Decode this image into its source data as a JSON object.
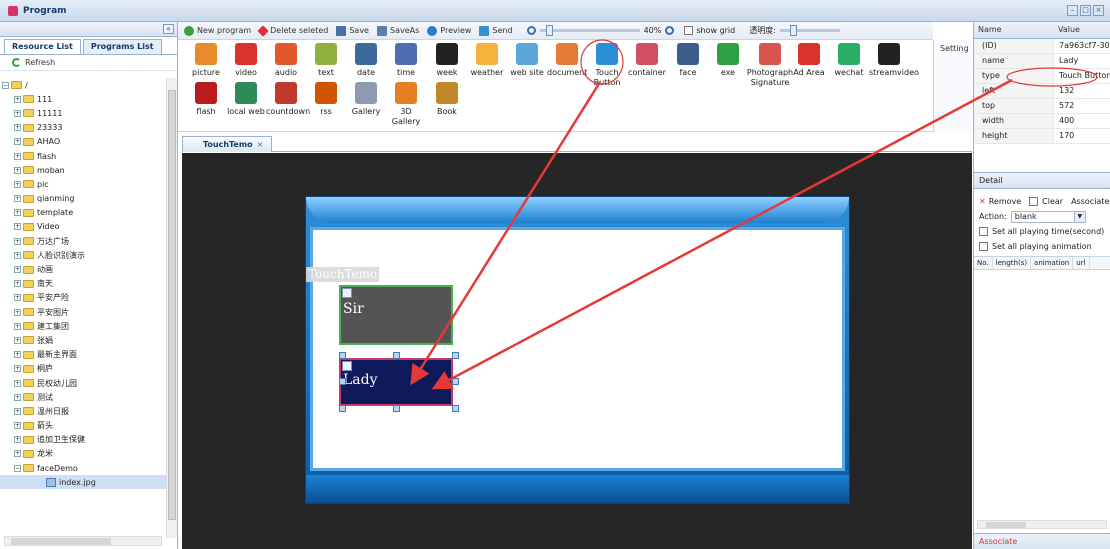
{
  "window": {
    "title": "Program"
  },
  "left_panel": {
    "tabs": [
      "Resource List",
      "Programs List"
    ],
    "refresh_label": "Refresh",
    "tree": [
      {
        "label": "/",
        "type": "root"
      },
      {
        "label": "111",
        "type": "folder"
      },
      {
        "label": "11111",
        "type": "folder"
      },
      {
        "label": "23333",
        "type": "folder"
      },
      {
        "label": "AHAO",
        "type": "folder"
      },
      {
        "label": "flash",
        "type": "folder"
      },
      {
        "label": "moban",
        "type": "folder"
      },
      {
        "label": "pic",
        "type": "folder"
      },
      {
        "label": "qianming",
        "type": "folder"
      },
      {
        "label": "template",
        "type": "folder"
      },
      {
        "label": "Video",
        "type": "folder"
      },
      {
        "label": "万达广场",
        "type": "folder"
      },
      {
        "label": "人脸识别演示",
        "type": "folder"
      },
      {
        "label": "动画",
        "type": "folder"
      },
      {
        "label": "南天",
        "type": "folder"
      },
      {
        "label": "平安产险",
        "type": "folder"
      },
      {
        "label": "平安图片",
        "type": "folder"
      },
      {
        "label": "建工集团",
        "type": "folder"
      },
      {
        "label": "张娟",
        "type": "folder"
      },
      {
        "label": "最新主界面",
        "type": "folder"
      },
      {
        "label": "桐庐",
        "type": "folder"
      },
      {
        "label": "民权幼儿园",
        "type": "folder"
      },
      {
        "label": "测试",
        "type": "folder"
      },
      {
        "label": "温州日报",
        "type": "folder"
      },
      {
        "label": "箭头",
        "type": "folder"
      },
      {
        "label": "追加卫生保健",
        "type": "folder"
      },
      {
        "label": "龙米",
        "type": "folder"
      },
      {
        "label": "faceDemo",
        "type": "folder-open"
      },
      {
        "label": "index.jpg",
        "type": "file"
      }
    ]
  },
  "toolbar": {
    "new_program": "New program",
    "delete_selected": "Delete seleted",
    "save": "Save",
    "saveas": "SaveAs",
    "preview": "Preview",
    "send": "Send",
    "zoom_value": "40%",
    "show_grid": "show grid",
    "opacity_label": "透明度:"
  },
  "palette": {
    "items": [
      {
        "label": "picture",
        "icon": "picture-icon",
        "color": "#e98b2a"
      },
      {
        "label": "video",
        "icon": "video-icon",
        "color": "#d9342b"
      },
      {
        "label": "audio",
        "icon": "audio-icon",
        "color": "#e2572b"
      },
      {
        "label": "text",
        "icon": "text-icon",
        "color": "#8fb13d"
      },
      {
        "label": "date",
        "icon": "date-icon",
        "color": "#3b6a9a"
      },
      {
        "label": "time",
        "icon": "time-icon",
        "color": "#4e6cb0"
      },
      {
        "label": "week",
        "icon": "week-icon",
        "color": "#222222"
      },
      {
        "label": "weather",
        "icon": "weather-icon",
        "color": "#f2b33d"
      },
      {
        "label": "web site",
        "icon": "website-icon",
        "color": "#5aa7d8"
      },
      {
        "label": "document",
        "icon": "document-icon",
        "color": "#e47a34"
      },
      {
        "label": "Touch Button",
        "icon": "touch-button-icon",
        "color": "#2b8fd8"
      },
      {
        "label": "container",
        "icon": "container-icon",
        "color": "#d24f63"
      },
      {
        "label": "face",
        "icon": "face-icon",
        "color": "#3c5c8b"
      },
      {
        "label": "exe",
        "icon": "exe-icon",
        "color": "#2ea043"
      },
      {
        "label": "Photograph Signature",
        "icon": "photograph-signature-icon",
        "color": "#d9534f"
      },
      {
        "label": "Ad Area",
        "icon": "ad-area-icon",
        "color": "#d9342b"
      },
      {
        "label": "wechat",
        "icon": "wechat-icon",
        "color": "#2aae67"
      },
      {
        "label": "streamvideo",
        "icon": "streamvideo-icon",
        "color": "#222222"
      },
      {
        "label": "flash",
        "icon": "flash-icon",
        "color": "#b81c1c"
      },
      {
        "label": "local web",
        "icon": "local-web-icon",
        "color": "#2e8b57"
      },
      {
        "label": "countdown",
        "icon": "countdown-icon",
        "color": "#c0392b"
      },
      {
        "label": "rss",
        "icon": "rss-icon",
        "color": "#d35400"
      },
      {
        "label": "Gallery",
        "icon": "gallery-icon",
        "color": "#8e9aaf"
      },
      {
        "label": "3D Gallery",
        "icon": "3d-gallery-icon",
        "color": "#e67e22"
      },
      {
        "label": "Book",
        "icon": "book-icon",
        "color": "#c0882a"
      }
    ],
    "setting_label": "Setting"
  },
  "editor": {
    "tab_label": "TouchTemo",
    "stage_label": "TouchTemo",
    "button_sir": "Sir",
    "button_lady": "Lady"
  },
  "properties": {
    "header": {
      "name": "Name",
      "value": "Value"
    },
    "rows": [
      {
        "name": "(ID)",
        "value": "7a963cf7-30..."
      },
      {
        "name": "name",
        "value": "Lady"
      },
      {
        "name": "type",
        "value": "Touch Button"
      },
      {
        "name": "left",
        "value": "132"
      },
      {
        "name": "top",
        "value": "572"
      },
      {
        "name": "width",
        "value": "400"
      },
      {
        "name": "height",
        "value": "170"
      }
    ]
  },
  "detail": {
    "title": "Detail",
    "remove": "Remove",
    "clear": "Clear",
    "associate": "Associate",
    "action_label": "Action:",
    "action_value": "blank",
    "set_time": "Set all playing time(second)",
    "set_animation": "Set all playing animation",
    "columns": [
      "No.",
      "length(s)",
      "animation",
      "url"
    ],
    "footer": "Associate"
  },
  "colors": {
    "accent": "#153c6b",
    "annotation": "#e53935"
  }
}
